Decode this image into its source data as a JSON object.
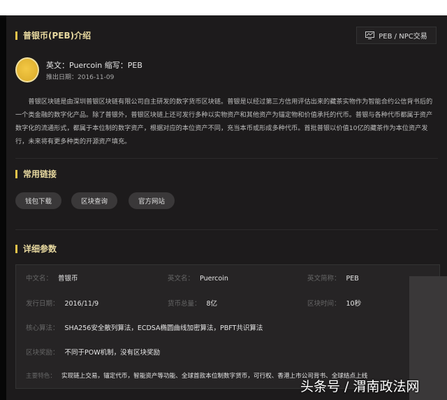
{
  "intro": {
    "title": "普银币(PEB)介绍",
    "trade_button": "PEB / NPC交易",
    "trade_icon": "chart-monitor-icon",
    "english_line": "英文：Puercoin 缩写：PEB",
    "launch_date": "推出日期：2016-11-09",
    "description": "普银区块链是由深圳普银区块链有限公司自主研发的数字货币区块链。普银是以经过第三方信用评估出来的藏茶实物作为智能合约公信背书后的一个类金融的数字化产品。除了普银外，普银区块链上还可发行多种以实物资产和其他资产为锚定物和价值承托的代币。普银与各种代币都属于资产数字化的流通形式，都属于本位制的数字资产，根据对应的本位资产不同，充当本币或形成多种代币。首批普银以价值10亿的藏茶作为本位资产发行，未来将有更多种类的开源资产填充。"
  },
  "links": {
    "title": "常用链接",
    "items": [
      "钱包下载",
      "区块查询",
      "官方网站"
    ]
  },
  "details": {
    "title": "详细参数",
    "rows": [
      [
        {
          "k": "中文名：",
          "v": "普银币"
        },
        {
          "k": "英文名：",
          "v": "Puercoin"
        },
        {
          "k": "英文简称：",
          "v": "PEB"
        }
      ],
      [
        {
          "k": "发行日期：",
          "v": "2016/11/9"
        },
        {
          "k": "货币总量：",
          "v": "8亿"
        },
        {
          "k": "区块时间：",
          "v": "10秒"
        }
      ],
      [
        {
          "k": "核心算法：",
          "v": "SHA256安全散列算法，ECDSA椭圆曲线加密算法，PBFT共识算法"
        }
      ],
      [
        {
          "k": "区块奖励：",
          "v": "不同于POW机制，没有区块奖励"
        }
      ],
      [
        {
          "k": "主要特色：",
          "v": "实现链上交易，锚定代币，智能资产等功能、全球首款本位制数字货币，可行权、香港上市公司背书、全球结点上线"
        }
      ]
    ]
  },
  "watermark": "头条号 / 渭南政法网"
}
